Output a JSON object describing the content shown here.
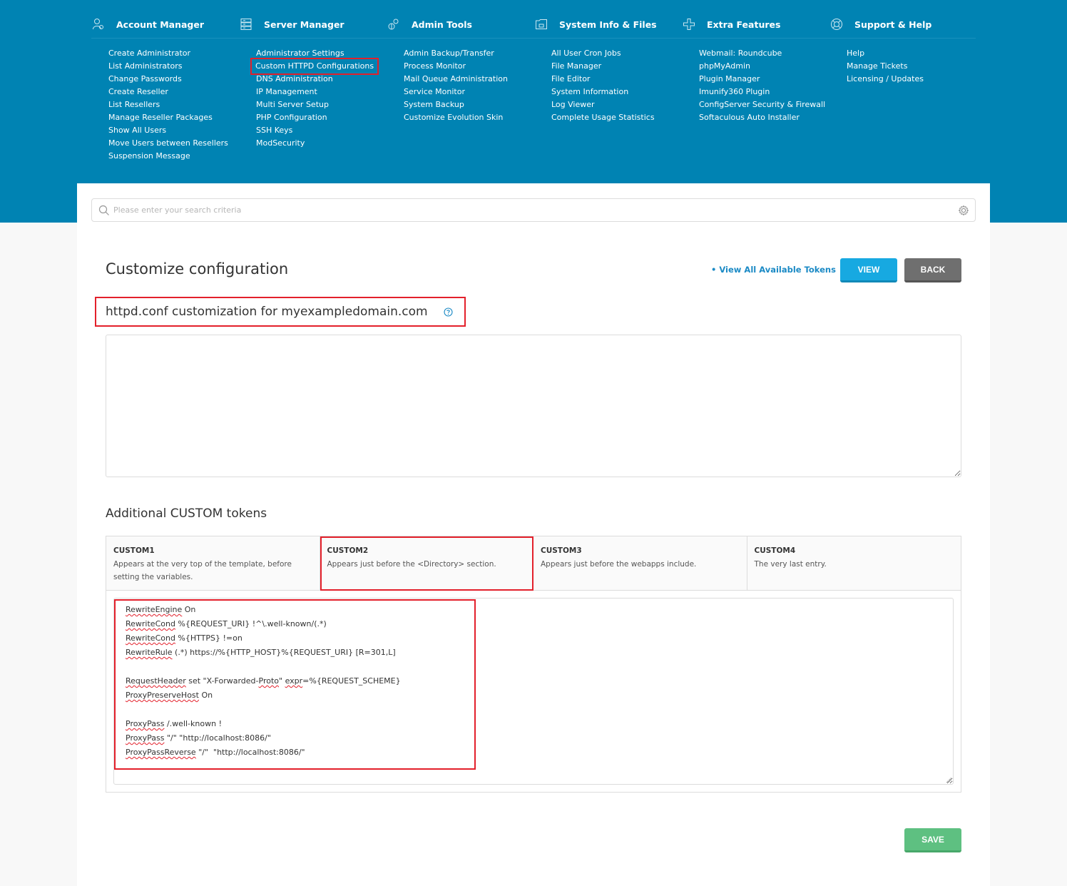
{
  "nav": {
    "columns": [
      {
        "title": "Account Manager",
        "icon": "users-icon",
        "items": [
          {
            "label": "Create Administrator"
          },
          {
            "label": "List Administrators"
          },
          {
            "label": "Change Passwords"
          },
          {
            "label": "Create Reseller"
          },
          {
            "label": "List Resellers"
          },
          {
            "label": "Manage Reseller Packages"
          },
          {
            "label": "Show All Users"
          },
          {
            "label": "Move Users between Resellers"
          },
          {
            "label": "Suspension Message"
          }
        ]
      },
      {
        "title": "Server Manager",
        "icon": "server-icon",
        "items": [
          {
            "label": "Administrator Settings"
          },
          {
            "label": "Custom HTTPD Configurations",
            "highlighted": true
          },
          {
            "label": "DNS Administration"
          },
          {
            "label": "IP Management"
          },
          {
            "label": "Multi Server Setup"
          },
          {
            "label": "PHP Configuration"
          },
          {
            "label": "SSH Keys"
          },
          {
            "label": "ModSecurity"
          }
        ]
      },
      {
        "title": "Admin Tools",
        "icon": "gears-icon",
        "items": [
          {
            "label": "Admin Backup/Transfer"
          },
          {
            "label": "Process Monitor"
          },
          {
            "label": "Mail Queue Administration"
          },
          {
            "label": "Service Monitor"
          },
          {
            "label": "System Backup"
          },
          {
            "label": "Customize Evolution Skin"
          }
        ]
      },
      {
        "title": "System Info & Files",
        "icon": "folder-icon",
        "items": [
          {
            "label": "All User Cron Jobs"
          },
          {
            "label": "File Manager"
          },
          {
            "label": "File Editor"
          },
          {
            "label": "System Information"
          },
          {
            "label": "Log Viewer"
          },
          {
            "label": "Complete Usage Statistics"
          }
        ]
      },
      {
        "title": "Extra Features",
        "icon": "plus-icon",
        "items": [
          {
            "label": "Webmail: Roundcube"
          },
          {
            "label": "phpMyAdmin"
          },
          {
            "label": "Plugin Manager"
          },
          {
            "label": "Imunify360 Plugin"
          },
          {
            "label": "ConfigServer Security & Firewall"
          },
          {
            "label": "Softaculous Auto Installer"
          }
        ]
      },
      {
        "title": "Support & Help",
        "icon": "lifebuoy-icon",
        "items": [
          {
            "label": "Help"
          },
          {
            "label": "Manage Tickets"
          },
          {
            "label": "Licensing / Updates"
          }
        ]
      }
    ]
  },
  "search": {
    "placeholder": "Please enter your search criteria",
    "value": ""
  },
  "page": {
    "title": "Customize configuration",
    "tokens_link": "• View All Available Tokens",
    "view_button": "VIEW",
    "back_button": "BACK",
    "subtitle": "httpd.conf customization for myexampledomain.com",
    "main_textarea_value": "",
    "custom_tokens_title": "Additional CUSTOM tokens",
    "save_button": "SAVE"
  },
  "tokens": [
    {
      "name": "CUSTOM1",
      "description": "Appears at the very top of the template, before setting the variables."
    },
    {
      "name": "CUSTOM2",
      "description": "Appears just before the <Directory> section.",
      "highlighted": true
    },
    {
      "name": "CUSTOM3",
      "description": "Appears just before the webapps include."
    },
    {
      "name": "CUSTOM4",
      "description": "The very last entry."
    }
  ],
  "code": {
    "lines": [
      [
        {
          "t": "RewriteEngine",
          "s": true
        },
        {
          "t": " On"
        }
      ],
      [
        {
          "t": "RewriteCond",
          "s": true
        },
        {
          "t": " %{REQUEST_URI} !^\\.well-known/(.*)"
        }
      ],
      [
        {
          "t": "RewriteCond",
          "s": true
        },
        {
          "t": " %{HTTPS} !=on"
        }
      ],
      [
        {
          "t": "RewriteRule",
          "s": true
        },
        {
          "t": " (.*) https://%{HTTP_HOST}%{REQUEST_URI} [R=301,L]"
        }
      ],
      [],
      [
        {
          "t": "RequestHeader",
          "s": true
        },
        {
          "t": " set \"X-Forwarded-"
        },
        {
          "t": "Proto",
          "s": true
        },
        {
          "t": "\" "
        },
        {
          "t": "expr",
          "s": true
        },
        {
          "t": "=%{REQUEST_SCHEME}"
        }
      ],
      [
        {
          "t": "ProxyPreserveHost",
          "s": true
        },
        {
          "t": " On"
        }
      ],
      [],
      [
        {
          "t": "ProxyPass",
          "s": true
        },
        {
          "t": " /.well-known !"
        }
      ],
      [
        {
          "t": "ProxyPass",
          "s": true
        },
        {
          "t": " \"/\" \"http://localhost:8086/\""
        }
      ],
      [
        {
          "t": "ProxyPassReverse",
          "s": true
        },
        {
          "t": " \"/\"  \"http://localhost:8086/\""
        }
      ]
    ]
  },
  "colors": {
    "nav_bg": "#0083b3",
    "highlight_red": "#e3202b",
    "view_button": "#17a9e1",
    "back_button": "#6f6f6f",
    "save_button": "#5ec081",
    "link_blue": "#1b8ac5"
  }
}
